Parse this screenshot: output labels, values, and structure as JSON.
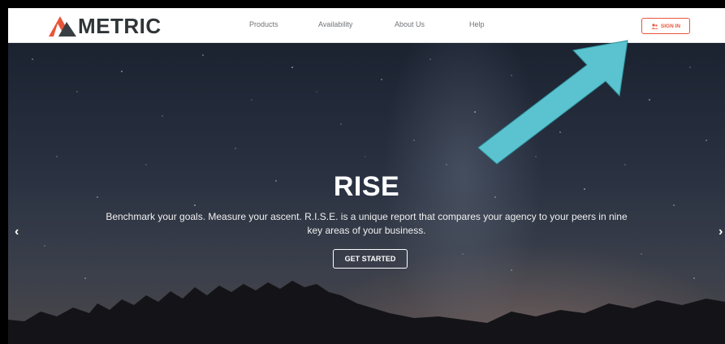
{
  "brand": {
    "name": "METRIC",
    "logo_color": "#e8563a"
  },
  "nav": {
    "items": [
      {
        "label": "Products"
      },
      {
        "label": "Availability"
      },
      {
        "label": "About Us"
      },
      {
        "label": "Help"
      }
    ],
    "signin_label": "SIGN IN",
    "signin_icon": "user-group-icon"
  },
  "hero": {
    "title": "RISE",
    "subtitle": "Benchmark your goals. Measure your ascent. R.I.S.E. is a unique report that compares your agency to your peers in nine key areas of your business.",
    "cta_label": "GET STARTED",
    "prev_arrow": "‹",
    "next_arrow": "›"
  },
  "annotation": {
    "arrow_color": "#5bc3cf"
  }
}
